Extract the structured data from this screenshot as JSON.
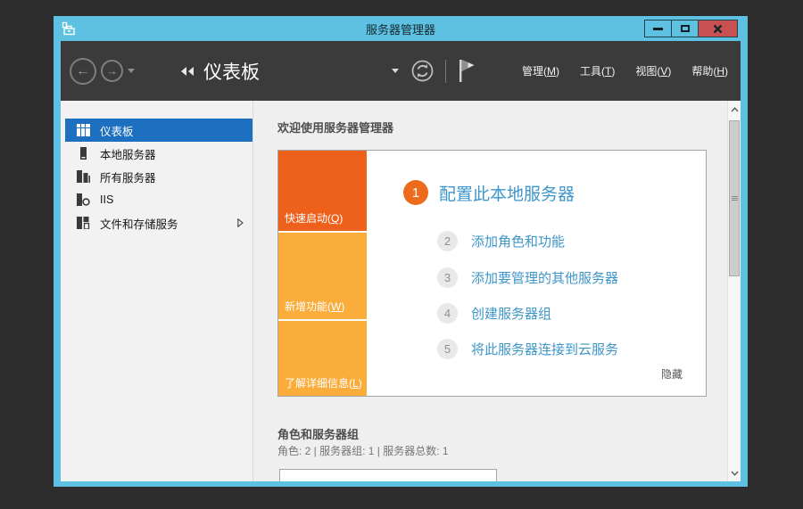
{
  "window": {
    "title": "服务器管理器"
  },
  "navbar": {
    "breadcrumb": "仪表板",
    "menus": [
      {
        "pre": "管理(",
        "key": "M",
        "post": ")"
      },
      {
        "pre": "工具(",
        "key": "T",
        "post": ")"
      },
      {
        "pre": "视图(",
        "key": "V",
        "post": ")"
      },
      {
        "pre": "帮助(",
        "key": "H",
        "post": ")"
      }
    ]
  },
  "sidebar": {
    "items": [
      {
        "label": "仪表板",
        "selected": true
      },
      {
        "label": "本地服务器"
      },
      {
        "label": "所有服务器"
      },
      {
        "label": "IIS"
      },
      {
        "label": "文件和存储服务",
        "expandable": true
      }
    ]
  },
  "main": {
    "welcome_header": "欢迎使用服务器管理器",
    "tiles": [
      {
        "pre": "快速启动(",
        "key": "Q",
        "post": ")"
      },
      {
        "pre": "新增功能(",
        "key": "W",
        "post": ")"
      },
      {
        "pre": "了解详细信息(",
        "key": "L",
        "post": ")"
      }
    ],
    "steps": [
      {
        "num": "1",
        "label": "配置此本地服务器"
      },
      {
        "num": "2",
        "label": "添加角色和功能"
      },
      {
        "num": "3",
        "label": "添加要管理的其他服务器"
      },
      {
        "num": "4",
        "label": "创建服务器组"
      },
      {
        "num": "5",
        "label": "将此服务器连接到云服务"
      }
    ],
    "hide_link": "隐藏",
    "roles": {
      "header": "角色和服务器组",
      "summary": "角色: 2 | 服务器组: 1 | 服务器总数: 1"
    }
  },
  "icons": {
    "back": "←",
    "forward": "→"
  },
  "colors": {
    "titlebar_blue": "#5ec1e2",
    "navbar_gray": "#3b3b3b",
    "close_red": "#c75050",
    "selected_blue": "#1d6fc0",
    "tile_orange_dark": "#ee611d",
    "tile_orange_light": "#fbad3c",
    "step1_circle_orange": "#ee6b1e",
    "link_blue": "#3e96c9"
  }
}
